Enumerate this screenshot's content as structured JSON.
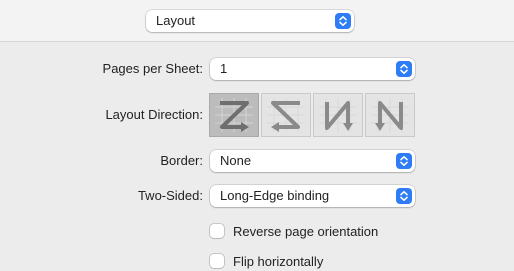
{
  "top": {
    "preset_value": "Layout"
  },
  "layout": {
    "pages_per_sheet": {
      "label": "Pages per Sheet:",
      "value": "1"
    },
    "layout_direction": {
      "label": "Layout Direction:",
      "options": [
        {
          "id": "z-left-to-right",
          "selected": true
        },
        {
          "id": "reverse-z",
          "selected": false
        },
        {
          "id": "n-top-to-bottom",
          "selected": false
        },
        {
          "id": "reverse-n",
          "selected": false
        }
      ]
    },
    "border": {
      "label": "Border:",
      "value": "None"
    },
    "two_sided": {
      "label": "Two-Sided:",
      "value": "Long-Edge binding"
    },
    "reverse_orientation": {
      "label": "Reverse page orientation",
      "checked": false
    },
    "flip_horizontally": {
      "label": "Flip horizontally",
      "checked": false
    }
  },
  "colors": {
    "accent": "#2e7cf6",
    "window_bg": "#ececec",
    "selected_direction_bg": "#bcbcbc"
  }
}
